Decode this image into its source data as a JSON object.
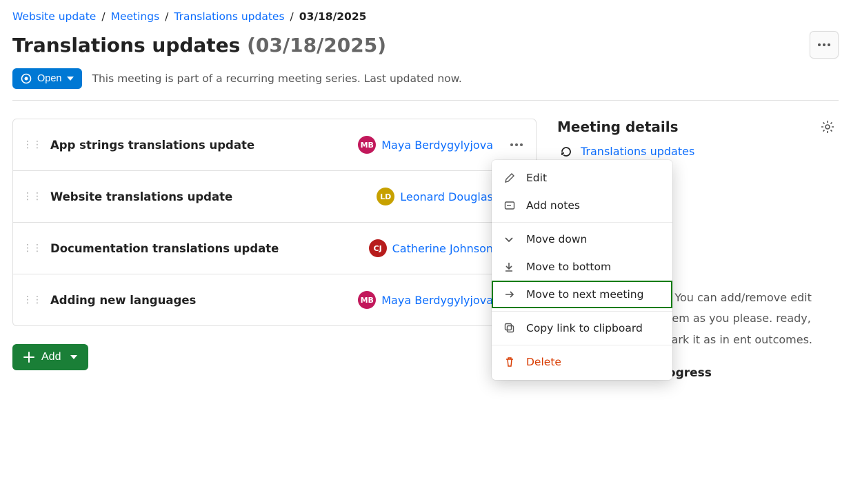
{
  "breadcrumb": {
    "items": [
      {
        "label": "Website update"
      },
      {
        "label": "Meetings"
      },
      {
        "label": "Translations updates"
      }
    ],
    "current": "03/18/2025"
  },
  "page": {
    "title": "Translations updates",
    "title_suffix": "(03/18/2025)"
  },
  "status": {
    "label": "Open",
    "note": "This meeting is part of a recurring meeting series. Last updated now."
  },
  "agenda": [
    {
      "title": "App strings translations update",
      "assignee": "Maya Berdygylyjova",
      "initials": "MB",
      "color": "#c2185b"
    },
    {
      "title": "Website translations update",
      "assignee": "Leonard Douglas",
      "initials": "LD",
      "color": "#c7a100"
    },
    {
      "title": "Documentation translations update",
      "assignee": "Catherine Johnson",
      "initials": "CJ",
      "color": "#b71c1c"
    },
    {
      "title": "Adding new languages",
      "assignee": "Maya Berdygylyjova",
      "initials": "MB",
      "color": "#c2185b"
    }
  ],
  "add_button": {
    "label": "Add"
  },
  "menu": {
    "edit": "Edit",
    "add_notes": "Add notes",
    "move_down": "Move down",
    "move_bottom": "Move to bottom",
    "move_next": "Move to next meeting",
    "copy": "Copy link to clipboard",
    "delete": "Delete"
  },
  "details": {
    "heading": "Meeting details",
    "recurrence_link": "Translations updates",
    "truncated": "T",
    "description": "n. You can add/remove edit them as you please. ready, mark it as in ent outcomes.",
    "progress_label": "Mark as in progress"
  }
}
